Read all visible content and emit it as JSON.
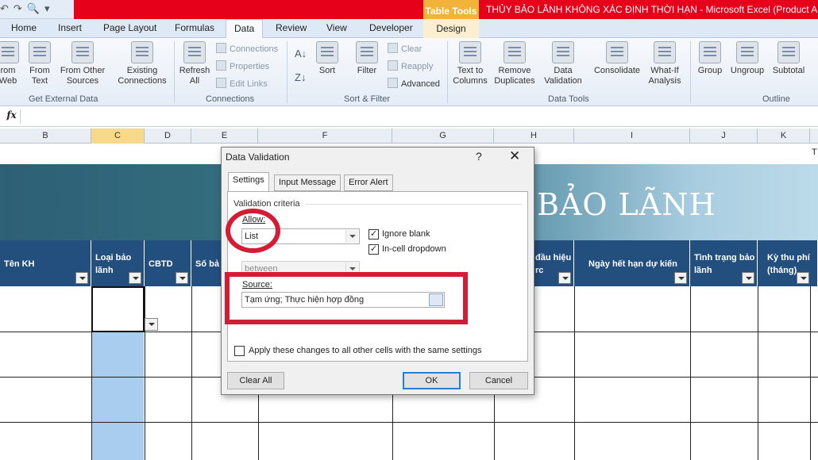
{
  "window": {
    "title": "THỦY BẢO LÃNH KHÔNG XÁC ĐỊNH THỜI HẠN  -  Microsoft Excel (Product A",
    "context_tab_group": "Table Tools"
  },
  "ribbon": {
    "tabs": [
      "Home",
      "Insert",
      "Page Layout",
      "Formulas",
      "Data",
      "Review",
      "View",
      "Developer"
    ],
    "active_tab": "Data",
    "context_tab": "Design",
    "get_external_data": {
      "label": "Get External Data",
      "web": "rom\nWeb",
      "text": "From\nText",
      "other": "From Other\nSources",
      "existing": "Existing\nConnections"
    },
    "connections": {
      "label": "Connections",
      "refresh": "Refresh\nAll",
      "connections": "Connections",
      "properties": "Properties",
      "edit_links": "Edit Links"
    },
    "sort_filter": {
      "label": "Sort & Filter",
      "sort": "Sort",
      "filter": "Filter",
      "clear": "Clear",
      "reapply": "Reapply",
      "advanced": "Advanced"
    },
    "data_tools": {
      "label": "Data Tools",
      "text_to_columns": "Text to\nColumns",
      "remove_duplicates": "Remove\nDuplicates",
      "data_validation": "Data\nValidation",
      "consolidate": "Consolidate",
      "what_if": "What-If\nAnalysis"
    },
    "outline": {
      "label": "Outline",
      "group": "Group",
      "ungroup": "Ungroup",
      "subtotal": "Subtotal"
    }
  },
  "formula_bar": {
    "fx": "fx",
    "value": ""
  },
  "sheet": {
    "columns": [
      "B",
      "C",
      "D",
      "E",
      "F",
      "G",
      "H",
      "I",
      "J",
      "K"
    ],
    "selected_column": "C",
    "banner_title": "BẢO LÃNH",
    "corner_text": "T",
    "headers": {
      "ten_kh": "Tên KH",
      "loai_bao_lanh": "Loại bảo\nlãnh",
      "cbtd": "CBTD",
      "so_bao": "Số bả",
      "dau_hieu": "đầu hiệu\nrc",
      "ngay_het_han": "Ngày hết hạn dự kiến",
      "tinh_trang": "Tình trạng bảo\nlãnh",
      "ky_thu_phi": "Kỳ thu phí\n(tháng)"
    }
  },
  "dialog": {
    "title": "Data Validation",
    "help": "?",
    "close": "✕",
    "tabs": [
      "Settings",
      "Input Message",
      "Error Alert"
    ],
    "active_tab": "Settings",
    "criteria_label": "Validation criteria",
    "allow_label": "Allow:",
    "allow_value": "List",
    "data_value": "between",
    "ignore_blank": "Ignore blank",
    "in_cell_dropdown": "In-cell dropdown",
    "ignore_blank_checked": true,
    "in_cell_dropdown_checked": true,
    "source_label": "Source:",
    "source_value": "Tạm ứng; Thực hiện hợp đồng",
    "apply_all": "Apply these changes to all other cells with the same settings",
    "apply_all_checked": false,
    "clear_all": "Clear All",
    "ok": "OK",
    "cancel": "Cancel"
  },
  "annotations": {
    "highlight_color": "#d51c35"
  }
}
